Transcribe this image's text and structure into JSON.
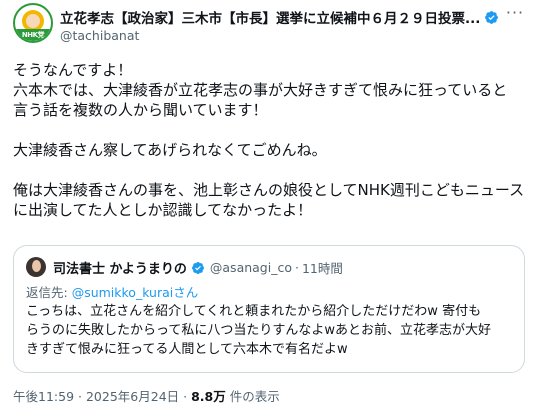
{
  "header": {
    "display_name": "立花孝志【政治家】三木市【市長】選挙に立候補中６月２９日投票...",
    "handle": "@tachibanat",
    "avatar_caption": "NHK党"
  },
  "body": {
    "lines": [
      "そうなんですよ！",
      "六本木では、大津綾香が立花孝志の事が大好きすぎて恨みに狂っていると",
      "言う話を複数の人から聞いています！",
      "大津綾香さん察してあげられなくてごめんね。",
      "俺は大津綾香さんの事を、池上彰さんの娘役としてNHK週刊こどもニュース",
      "に出演してた人としか認識してなかったよ！"
    ]
  },
  "quote": {
    "display_name": "司法書士 かようまりの",
    "handle": "@asanagi_co",
    "separator": "·",
    "time": "11時間",
    "reply_prefix": "返信先: ",
    "reply_handle": "@sumikko_kuraiさん",
    "lines": [
      "こっちは、立花さんを紹介してくれと頼まれたから紹介しただけだわw 寄付も",
      "らうのに失敗したからって私に八つ当たりすんなよwあとお前、立花孝志が大好",
      "きすぎて恨みに狂ってる人間として六本木で有名だよw"
    ]
  },
  "meta": {
    "time": "午後11:59",
    "separator": "·",
    "date": "2025年6月24日",
    "views_count": "8.8万",
    "views_label": "件の表示"
  },
  "colors": {
    "verified": "#1d9bf0",
    "secondary_text": "#536471",
    "border": "#cfd9de"
  }
}
